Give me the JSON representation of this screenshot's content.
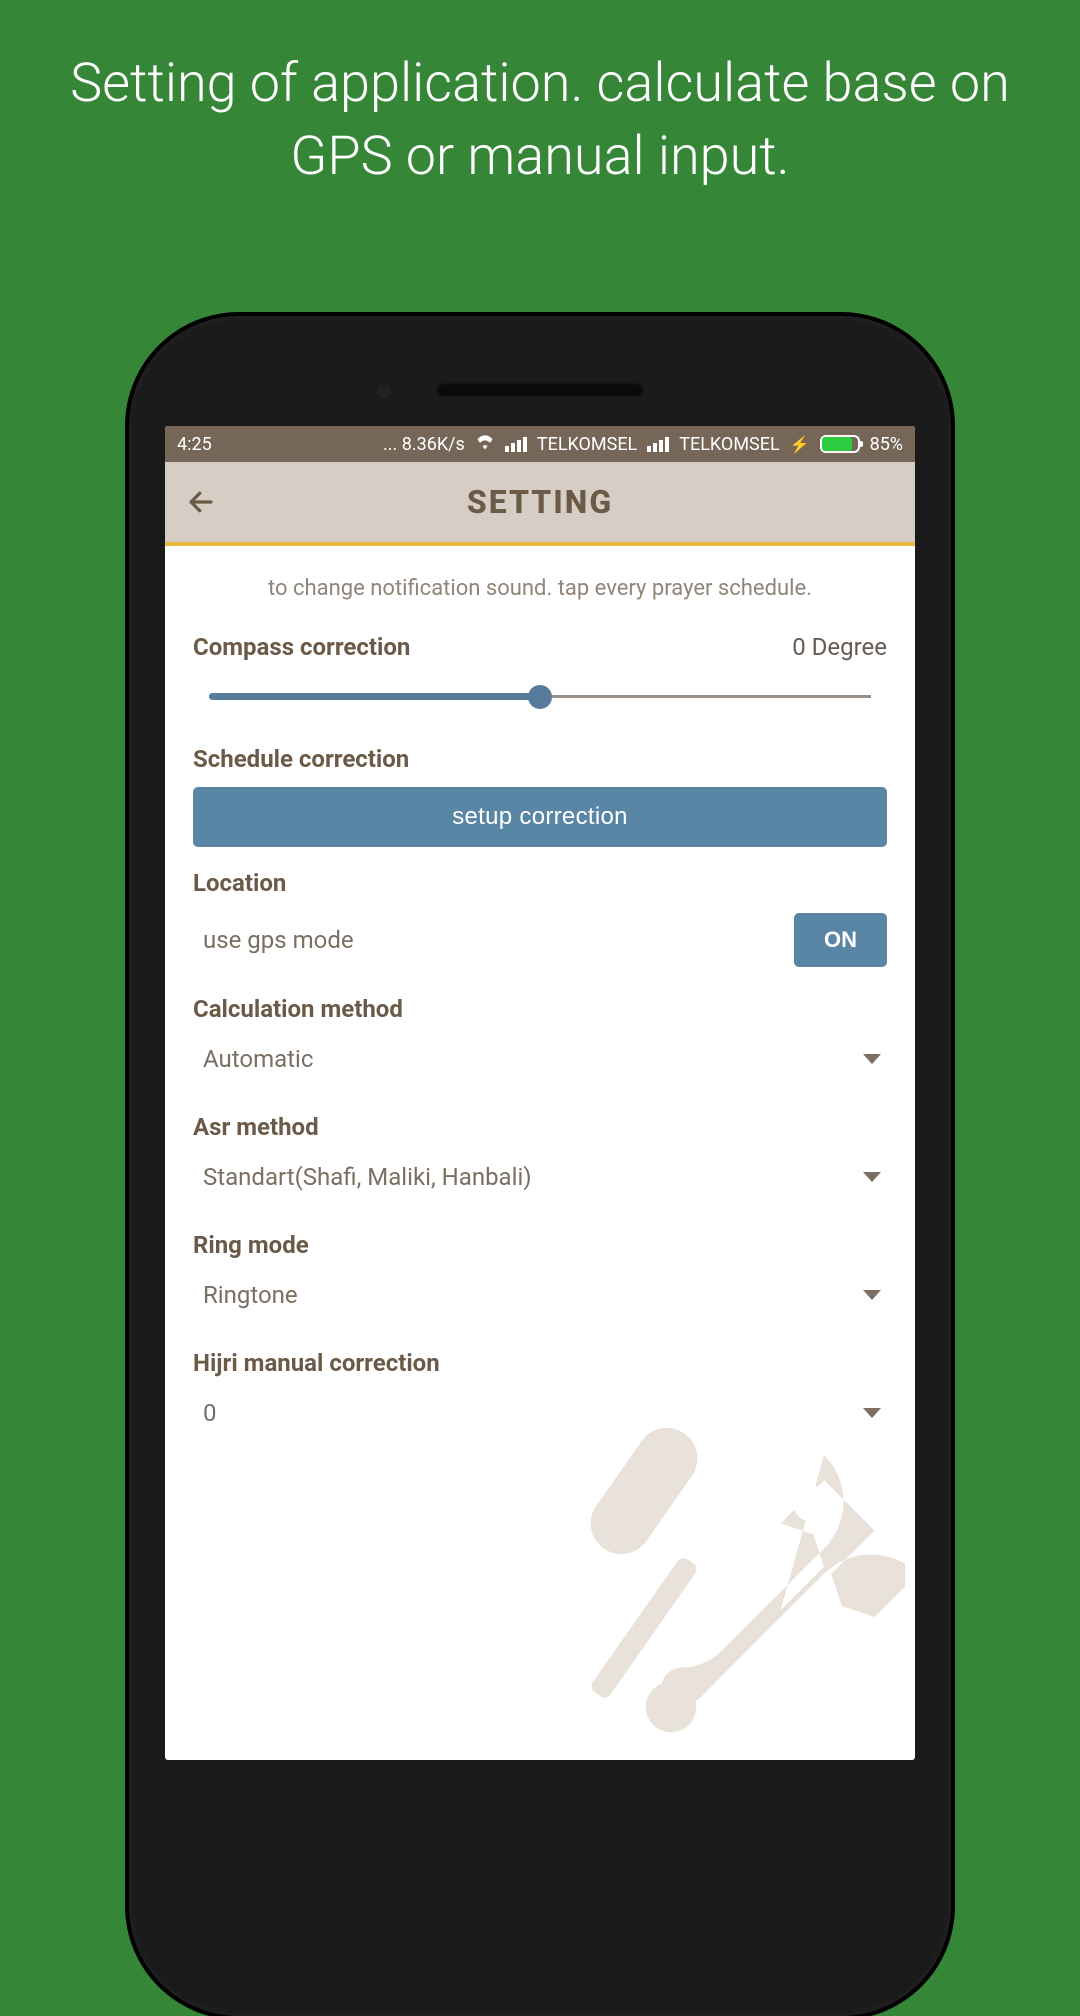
{
  "promo": {
    "headline": "Setting of application. calculate base on GPS or manual input."
  },
  "statusbar": {
    "time": "4:25",
    "net_speed": "... 8.36K/s",
    "carrier1": "TELKOMSEL",
    "carrier2": "TELKOMSEL",
    "battery_pct": "85%"
  },
  "appbar": {
    "title": "SETTING"
  },
  "settings": {
    "hint": "to change notification sound. tap every prayer schedule.",
    "compass": {
      "label": "Compass correction",
      "value": "0 Degree",
      "slider_percent": 50
    },
    "schedule": {
      "label": "Schedule correction",
      "button": "setup correction"
    },
    "location": {
      "label": "Location",
      "option": "use gps mode",
      "toggle": "ON"
    },
    "calc_method": {
      "label": "Calculation method",
      "value": "Automatic"
    },
    "asr_method": {
      "label": "Asr method",
      "value": "Standart(Shafi, Maliki, Hanbali)"
    },
    "ring_mode": {
      "label": "Ring mode",
      "value": "Ringtone"
    },
    "hijri": {
      "label": "Hijri manual correction",
      "value": "0"
    }
  }
}
